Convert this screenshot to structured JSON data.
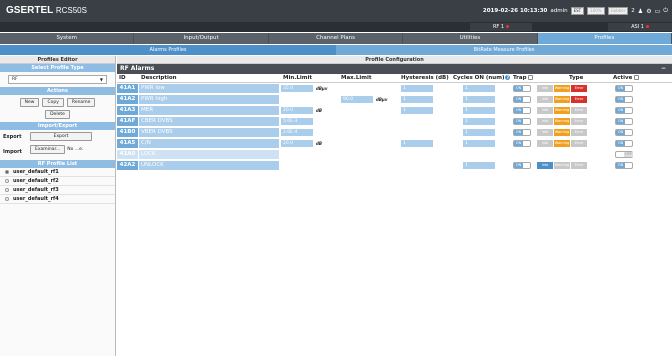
{
  "brand": {
    "name": "GSERTEL",
    "model": "RCS50S"
  },
  "topbar": {
    "datetime": "2019-02-26 10:13:30",
    "user": "admin",
    "lang": "EST",
    "mode": "100%",
    "extra": "Gabber",
    "count": "2"
  },
  "status": {
    "rf": "RF 1",
    "asi": "ASI 1"
  },
  "nav": [
    "System",
    "Input/Output",
    "Channel Plans",
    "Utilities",
    "Profiles"
  ],
  "subnav": [
    "Alarms Profiles",
    "BitRate Measure Profiles"
  ],
  "sidebar": {
    "editor_title": "Profiles Editor",
    "select_title": "Select Profile Type",
    "select_value": "RF",
    "actions_title": "Actions",
    "new": "New",
    "copy": "Copy",
    "rename": "Rename",
    "delete": "Delete",
    "import_title": "Import/Export",
    "export_label": "Export",
    "export_btn": "Export",
    "import_label": "Import",
    "browse_btn": "Examinar...",
    "file_text": "No ...e.",
    "list_title": "RF Profile List",
    "profiles": [
      "user_default_rf1",
      "user_default_rf2",
      "user_default_rf3",
      "user_default_rf4"
    ]
  },
  "content": {
    "config_title": "Profile Configuration",
    "section_title": "RF Alarms",
    "minimize": "−",
    "headers": {
      "id": "ID",
      "desc": "Description",
      "min": "Min.Limit",
      "max": "Max.Limit",
      "hyst": "Hysteresis (dB)",
      "cycles": "Cycles ON (num)",
      "trap": "Trap",
      "type": "Type",
      "active": "Active"
    },
    "toggle_on": "ON",
    "toggle_off": "OFF",
    "levels": {
      "info": "Info",
      "warning": "Warning",
      "error": "Error"
    },
    "rows": [
      {
        "id": "41A1",
        "desc": "PWR low",
        "min": "35.0",
        "min_unit": "dBμv",
        "max": "",
        "max_unit": "",
        "hyst": "1",
        "cycles": "1",
        "type": "error",
        "disabled": false
      },
      {
        "id": "41A2",
        "desc": "PWR high",
        "min": "",
        "min_unit": "",
        "max": "90.0",
        "max_unit": "dBμv",
        "hyst": "1",
        "cycles": "1",
        "type": "error",
        "disabled": false
      },
      {
        "id": "41A3",
        "desc": "MER",
        "min": "20.0",
        "min_unit": "dB",
        "max": "",
        "max_unit": "",
        "hyst": "1",
        "cycles": "1",
        "type": "warning",
        "disabled": false
      },
      {
        "id": "41AF",
        "desc": "CBER DVBS",
        "min": "5.0E-3",
        "min_unit": "",
        "max": "",
        "max_unit": "",
        "hyst": "",
        "cycles": "1",
        "type": "warning",
        "disabled": false
      },
      {
        "id": "41B0",
        "desc": "VBER DVBS",
        "min": "2.0E-4",
        "min_unit": "",
        "max": "",
        "max_unit": "",
        "hyst": "",
        "cycles": "1",
        "type": "warning",
        "disabled": false
      },
      {
        "id": "41A5",
        "desc": "C/N",
        "min": "20.0",
        "min_unit": "dB",
        "max": "",
        "max_unit": "",
        "hyst": "1",
        "cycles": "1",
        "type": "warning",
        "disabled": false
      },
      {
        "id": "41A0",
        "desc": "LOCK",
        "min": "",
        "min_unit": "",
        "max": "",
        "max_unit": "",
        "hyst": "",
        "cycles": "",
        "type": "",
        "disabled": true
      },
      {
        "id": "42A2",
        "desc": "UNLOCK",
        "min": "",
        "min_unit": "",
        "max": "",
        "max_unit": "",
        "hyst": "",
        "cycles": "1",
        "type": "info",
        "disabled": false
      }
    ]
  }
}
